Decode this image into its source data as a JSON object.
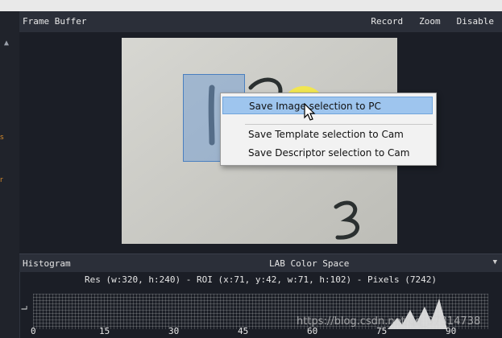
{
  "frame_buffer": {
    "title": "Frame Buffer",
    "actions": [
      "Record",
      "Zoom",
      "Disable"
    ]
  },
  "context_menu": {
    "items": [
      "Save Image selection to PC",
      "Save Template selection to Cam",
      "Save Descriptor selection to Cam"
    ],
    "active_index": 0
  },
  "histogram": {
    "title": "Histogram",
    "color_space": "LAB Color Space",
    "info": "Res (w:320, h:240) - ROI (x:71, y:42, w:71, h:102) - Pixels (7242)",
    "y_label": "L",
    "x_ticks": [
      "0",
      "15",
      "30",
      "45",
      "60",
      "75",
      "90"
    ]
  },
  "watermark": "https://blog.csdn.net/qq_37314738",
  "colors": {
    "panel_bg": "#1b1e26",
    "header_bg": "#2b2f39",
    "menu_highlight": "#9ec5ee",
    "cursor_halo": "#f8eb3c"
  }
}
